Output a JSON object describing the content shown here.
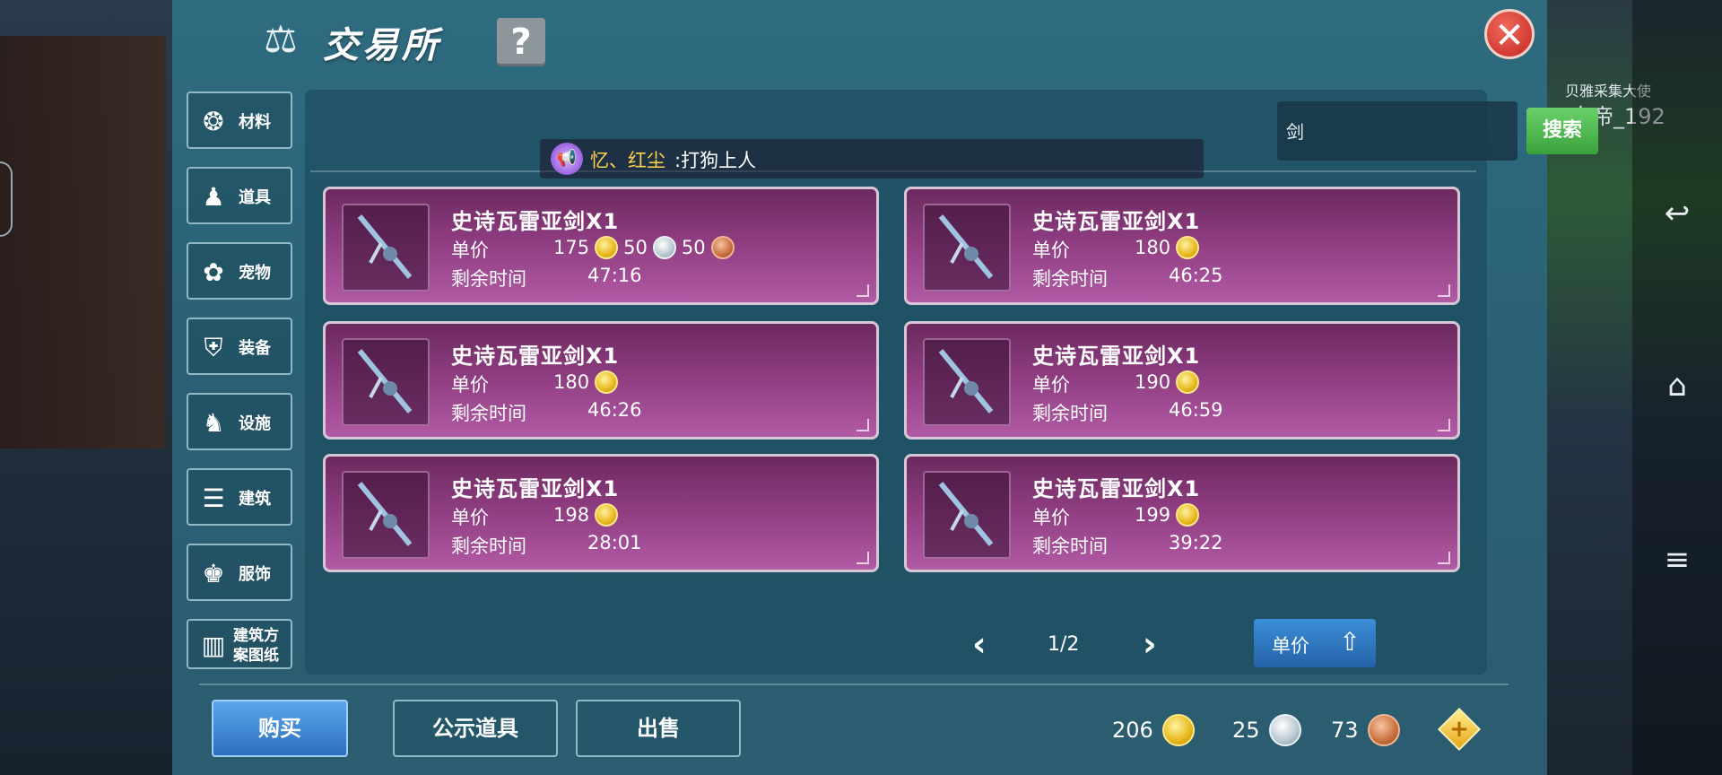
{
  "background": {
    "npc_title": "贝雅采集大使",
    "npc_name": "白帝_192"
  },
  "window": {
    "title": "交易所",
    "help_label": "?",
    "close_label": "✕"
  },
  "categories": [
    {
      "label": "材料",
      "icon": "materials-icon"
    },
    {
      "label": "道具",
      "icon": "items-icon"
    },
    {
      "label": "宠物",
      "icon": "paw-icon"
    },
    {
      "label": "装备",
      "icon": "equipment-icon"
    },
    {
      "label": "设施",
      "icon": "facility-icon"
    },
    {
      "label": "建筑",
      "icon": "building-icon"
    },
    {
      "label": "服饰",
      "icon": "clothing-icon"
    },
    {
      "label": "建筑方案图纸",
      "icon": "blueprint-icon"
    }
  ],
  "search": {
    "value": "剑",
    "button": "搜索"
  },
  "broadcast": {
    "name": "忆、红尘",
    "message": ":打狗上人"
  },
  "listings": [
    {
      "name": "史诗瓦雷亚剑X1",
      "price_label": "单价",
      "gold": "175",
      "silver": "50",
      "copper": "50",
      "time_label": "剩余时间",
      "time": "47:16"
    },
    {
      "name": "史诗瓦雷亚剑X1",
      "price_label": "单价",
      "gold": "180",
      "time_label": "剩余时间",
      "time": "46:25"
    },
    {
      "name": "史诗瓦雷亚剑X1",
      "price_label": "单价",
      "gold": "180",
      "time_label": "剩余时间",
      "time": "46:26"
    },
    {
      "name": "史诗瓦雷亚剑X1",
      "price_label": "单价",
      "gold": "190",
      "time_label": "剩余时间",
      "time": "46:59"
    },
    {
      "name": "史诗瓦雷亚剑X1",
      "price_label": "单价",
      "gold": "198",
      "time_label": "剩余时间",
      "time": "28:01"
    },
    {
      "name": "史诗瓦雷亚剑X1",
      "price_label": "单价",
      "gold": "199",
      "time_label": "剩余时间",
      "time": "39:22"
    }
  ],
  "pager": {
    "text": "1/2"
  },
  "sort": {
    "label": "单价"
  },
  "tabs": {
    "buy": "购买",
    "public": "公示道具",
    "sell": "出售"
  },
  "currency": {
    "gold": "206",
    "silver": "25",
    "copper": "73"
  },
  "colors": {
    "card": "#8e3c80",
    "accent_green": "#3aa23d",
    "accent_blue": "#2d6fbf",
    "close_red": "#c6261f"
  }
}
